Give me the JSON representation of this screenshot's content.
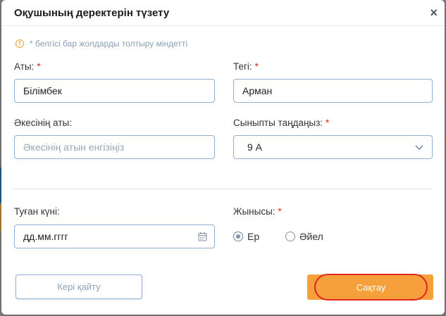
{
  "dialog": {
    "title": "Оқушының деректерін түзету",
    "close": "×"
  },
  "notice": {
    "icon": "info-icon",
    "text": "* белгісі бар жолдарды толтыру міндетті"
  },
  "form": {
    "required_mark": "*",
    "first_name": {
      "label": "Аты:",
      "value": "Білімбек"
    },
    "last_name": {
      "label": "Тегі:",
      "value": "Арман"
    },
    "father_name": {
      "label": "Әкесінің аты:",
      "placeholder": "Әкесінің атын енгізіңіз"
    },
    "class_select": {
      "label": "Сыныпты таңдаңыз:",
      "value": "9 А"
    },
    "birth_date": {
      "label": "Туған күні:",
      "placeholder": "дд.мм.гггг"
    },
    "gender": {
      "label": "Жынысы:",
      "options": [
        "Ер",
        "Әйел"
      ],
      "selected": "Ер"
    }
  },
  "buttons": {
    "cancel": "Кері қайту",
    "save": "Сақтау"
  },
  "colors": {
    "accent": "#f5a03b",
    "required": "#e0251e",
    "input_border": "#8fb1d4"
  }
}
